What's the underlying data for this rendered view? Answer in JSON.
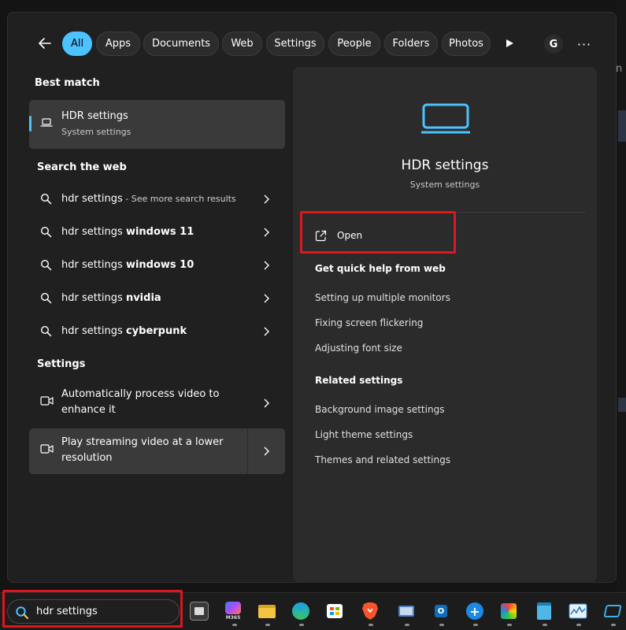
{
  "filters": {
    "tabs": [
      "All",
      "Apps",
      "Documents",
      "Web",
      "Settings",
      "People",
      "Folders",
      "Photos"
    ],
    "avatar_initial": "G",
    "more_label": "···"
  },
  "best_match": {
    "heading": "Best match",
    "title": "HDR settings",
    "subtitle": "System settings",
    "icon": "laptop-icon"
  },
  "web": {
    "heading": "Search the web",
    "items": [
      {
        "prefix": "hdr settings",
        "bold": "",
        "suffix": " - See more search results"
      },
      {
        "prefix": "hdr settings ",
        "bold": "windows 11",
        "suffix": ""
      },
      {
        "prefix": "hdr settings ",
        "bold": "windows 10",
        "suffix": ""
      },
      {
        "prefix": "hdr settings ",
        "bold": "nvidia",
        "suffix": ""
      },
      {
        "prefix": "hdr settings ",
        "bold": "cyberpunk",
        "suffix": ""
      }
    ]
  },
  "settings": {
    "heading": "Settings",
    "items": [
      {
        "label": "Automatically process video to enhance it",
        "icon": "video-camera-icon"
      },
      {
        "label": "Play streaming video at a lower resolution",
        "icon": "video-camera-icon"
      }
    ]
  },
  "preview": {
    "title": "HDR settings",
    "subtitle": "System settings",
    "open_label": "Open",
    "quick_help_heading": "Get quick help from web",
    "quick_help_links": [
      "Setting up multiple monitors",
      "Fixing screen flickering",
      "Adjusting font size"
    ],
    "related_heading": "Related settings",
    "related_links": [
      "Background image settings",
      "Light theme settings",
      "Themes and related settings"
    ]
  },
  "taskbar": {
    "search_value": "hdr settings",
    "m365_label": "M365"
  },
  "colors": {
    "accent": "#4cc2ff",
    "highlight_red": "#e0161d"
  }
}
